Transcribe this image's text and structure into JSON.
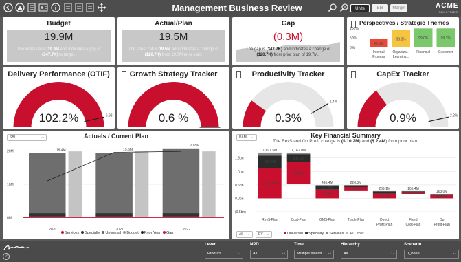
{
  "header": {
    "title": "Management Business Review",
    "toggle": {
      "units": "Units",
      "bbl": "Bbl",
      "margin": "Margin"
    },
    "logo": {
      "name": "ACME",
      "tag": "INDUSTRIES"
    },
    "icons": [
      "back-icon",
      "home-icon",
      "report-icon",
      "excel-icon",
      "info-icon",
      "bookmark-icon",
      "bookmark-icon",
      "bookmark-icon",
      "move-icon",
      "drill-up-icon",
      "drill-down-icon"
    ]
  },
  "kpis": {
    "budget": {
      "title": "Budget",
      "value": "19.9M",
      "note_pre": "The latest call is ",
      "note_a": "19.9M",
      "note_mid": " and indicates a gap of ",
      "note_b": "(347.7K)",
      "note_post": " to target."
    },
    "actual": {
      "title": "Actual/Plan",
      "value": "19.5M",
      "note_pre": "The latest call is ",
      "note_a": "19.5M",
      "note_mid": " and indicates a change of ",
      "note_b": "(120.7K)",
      "note_post": " from 19.7M prior plan."
    },
    "gap": {
      "title": "Gap",
      "value": "(0.3M)",
      "note_pre": "The gap is ",
      "note_a": "(347.7K)",
      "note_mid": " and indicates a change of ",
      "note_b": "(120.7K)",
      "note_post": " from prior plan of 19.7M.."
    }
  },
  "themes": {
    "title": "Perspectives / Strategic Themes",
    "chart_data": {
      "type": "bar",
      "categories": [
        "Internal Process",
        "Organiza... Learning...",
        "Financial",
        "Customer"
      ],
      "values": [
        43.0,
        90.3,
        99.0,
        99.1
      ],
      "labels": [
        "43.0%",
        "90.3%",
        "99.0%",
        "99.1%"
      ],
      "colors": [
        "#e8493a",
        "#f5c542",
        "#7bc86c",
        "#7bc86c"
      ],
      "yticks": [
        "100%",
        "50%",
        "0%"
      ],
      "ylim": [
        0,
        100
      ]
    }
  },
  "gauges": [
    {
      "title": "Delivery Performance (OTIF)",
      "value": "102.2%",
      "target": "6.92",
      "fill": 1.0,
      "target_frac": 0.93
    },
    {
      "title": "Growth Strategy Tracker",
      "value": "0.6 %",
      "target": "",
      "fill": 1.0,
      "target_frac": 1.0
    },
    {
      "title": "Productivity Tracker",
      "value": "0.3%",
      "target": "1.4%",
      "fill": 0.2,
      "target_frac": 0.83
    },
    {
      "title": "CapEx Tracker",
      "value": "0.9%",
      "target": "2.2%",
      "fill": 0.3,
      "target_frac": 0.93
    }
  ],
  "actuals": {
    "title": "Actuals / Current Plan",
    "dropdown": "SBU",
    "legend": [
      {
        "name": "Services",
        "color": "#c8102e"
      },
      {
        "name": "Specialty",
        "color": "#333333"
      },
      {
        "name": "Universal",
        "color": "#666666"
      },
      {
        "name": "Budget",
        "color": "#999999"
      },
      {
        "name": "Prior Year",
        "color": "#222222"
      },
      {
        "name": "Gap",
        "color": "#c8102e"
      }
    ],
    "chart_data": {
      "type": "bar",
      "categories": [
        "2020",
        "2021",
        "2022"
      ],
      "ylim": [
        -2,
        22
      ],
      "yticks": [
        "20M",
        "10M",
        "0M"
      ],
      "totals": [
        19.4,
        19.5,
        20.8
      ],
      "total_labels": [
        "19.4M",
        "19.5M",
        "20.8M"
      ],
      "series": [
        {
          "name": "Services",
          "values": [
            0.3,
            0.3,
            0.3
          ]
        },
        {
          "name": "Specialty",
          "values": [
            1.0,
            1.0,
            1.0
          ]
        },
        {
          "name": "Universal",
          "values": [
            18.1,
            18.2,
            19.5
          ]
        }
      ],
      "budget": [
        19.9,
        19.9,
        19.9
      ],
      "prior_year": [
        11.0,
        19.6,
        19.9
      ]
    }
  },
  "financial": {
    "title": "Key Financial Summary",
    "subtitle_pre": "The Rev$ and Op Profit change is ",
    "subtitle_a": "$ 10.2M",
    "subtitle_mid": ") and ",
    "subtitle_b": "$ 2.4M",
    "subtitle_post": ") from prior plan.",
    "dropdown": "P&M",
    "dropdown2": "All",
    "dropdown3": "EY",
    "legend": [
      {
        "name": "Universal",
        "color": "#c8102e"
      },
      {
        "name": "Specialty",
        "color": "#333333"
      },
      {
        "name": "Services",
        "color": "#888888"
      },
      {
        "name": "All Other",
        "color": "#bbbbbb"
      }
    ],
    "chart_data": {
      "type": "bar",
      "categories": [
        "Rev$-Plan",
        "Cost-Plan",
        "GM$-Plan",
        "Trade-Plan",
        "Direct Profit-Plan",
        "Fixed Cost-Plan",
        "Op Profit-Plan"
      ],
      "yticks": [
        "1.5bn",
        "1.0bn",
        "0.5bn",
        "0.0bn",
        "(0.5bn)"
      ],
      "ylim": [
        -0.5,
        1.9
      ],
      "totals": [
        "1,697.5M",
        "1,162.0M",
        "495.4M",
        "226.3M",
        "269.1M",
        "105.4M",
        "163.0M"
      ],
      "bars": [
        {
          "start": 0,
          "end": 1.6975,
          "segs": [
            [
              "Universal",
              1.129,
              "1,129.6M"
            ],
            [
              "Specialty",
              0.4585,
              "458.4M"
            ],
            [
              "Services",
              0.11,
              ""
            ]
          ]
        },
        {
          "start": 1.6975,
          "end": 0.5355,
          "segs": [
            [
              "Universal",
              0.8038,
              "803.8M"
            ],
            [
              "Specialty",
              0.3016,
              "301.6M"
            ],
            [
              "Services",
              0.056,
              ""
            ]
          ]
        },
        {
          "start": 0,
          "end": 0.4954,
          "segs": [
            [
              "Universal",
              0.3248,
              "324.8M"
            ],
            [
              "Specialty",
              0.151,
              "151.0M"
            ],
            [
              "Services",
              0.02,
              ""
            ]
          ]
        },
        {
          "start": 0.4954,
          "end": 0.2691,
          "segs": [
            [
              "Universal",
              0.1501,
              "150.1M"
            ],
            [
              "Specialty",
              0.06,
              ""
            ],
            [
              "Services",
              0.0163,
              ""
            ]
          ]
        },
        {
          "start": 0,
          "end": 0.2691,
          "segs": [
            [
              "Universal",
              0.1742,
              "174.2M"
            ],
            [
              "Specialty",
              0.08,
              ""
            ],
            [
              "Services",
              0.0149,
              ""
            ]
          ]
        },
        {
          "start": 0.2691,
          "end": 0.1637,
          "segs": [
            [
              "Universal",
              0.06,
              ""
            ],
            [
              "Specialty",
              0.03,
              ""
            ],
            [
              "Services",
              0.0154,
              ""
            ]
          ]
        },
        {
          "start": 0,
          "end": 0.163,
          "segs": [
            [
              "Universal",
              0.12,
              "163.0M"
            ],
            [
              "Specialty",
              0.03,
              ""
            ],
            [
              "Services",
              0.013,
              ""
            ]
          ]
        }
      ]
    }
  },
  "footer": {
    "filters": [
      {
        "label": "Lever",
        "value": "Product"
      },
      {
        "label": "NPD",
        "value": "All"
      },
      {
        "label": "Time",
        "value": "Multiple selecti..."
      },
      {
        "label": "Hierarchy",
        "value": "All"
      },
      {
        "label": "Scenario",
        "value": "0_Base"
      }
    ]
  }
}
